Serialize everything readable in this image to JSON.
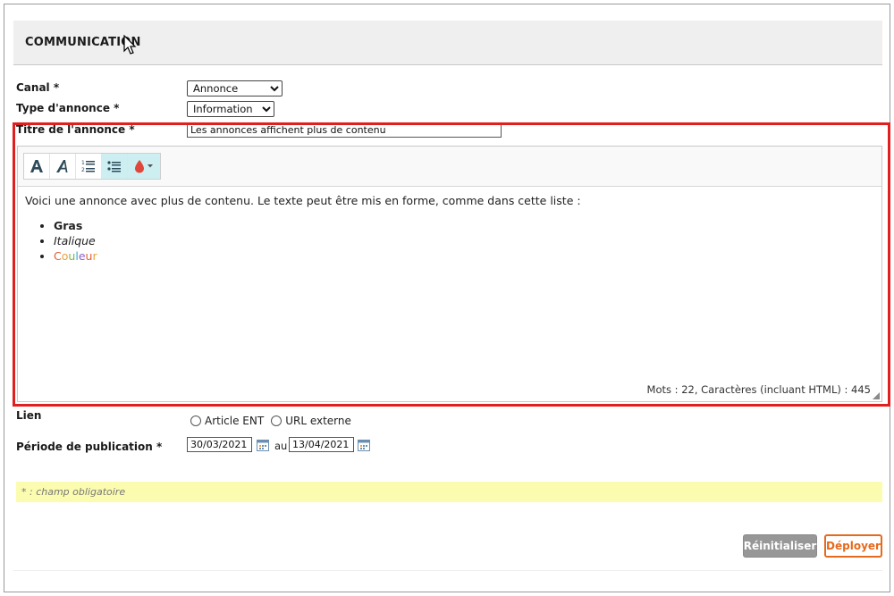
{
  "section": {
    "title": "COMMUNICATION"
  },
  "form": {
    "canal": {
      "label": "Canal *",
      "value": "Annonce",
      "options": [
        "Annonce"
      ]
    },
    "type_annonce": {
      "label": "Type d'annonce *",
      "value": "Information",
      "options": [
        "Information"
      ]
    },
    "titre": {
      "label": "Titre de l'annonce *",
      "value": "Les annonces affichent plus de contenu"
    }
  },
  "editor": {
    "toolbar": [
      "bold-a-icon",
      "italic-a-icon",
      "ordered-list-icon",
      "unordered-list-icon",
      "text-color-icon"
    ],
    "paragraph": "Voici une annonce avec plus de contenu. Le texte peut être mis en forme, comme dans cette liste :",
    "list_items": {
      "bold": "Gras",
      "italic": "Italique"
    },
    "color_word": [
      "C",
      "o",
      "u",
      "l",
      "e",
      "u",
      "r"
    ],
    "color_word_colors": [
      "#e25d33",
      "#e8a33c",
      "#7ab648",
      "#3aa5d4",
      "#8a63c9",
      "#e25d33",
      "#e8a33c"
    ],
    "word_count": "Mots : 22, Caractères (incluant HTML) : 445"
  },
  "lien": {
    "label": "Lien",
    "options": [
      "Article ENT",
      "URL externe"
    ]
  },
  "publication": {
    "label": "Période de publication *",
    "from": "30/03/2021",
    "separator": "au",
    "to": "13/04/2021"
  },
  "required_note": "* : champ obligatoire",
  "buttons": {
    "reset": "Réinitialiser",
    "deploy": "Déployer"
  },
  "colors": {
    "accent": "#e56a1c",
    "highlight": "#e02020",
    "note_bg": "#fcfcb0"
  }
}
